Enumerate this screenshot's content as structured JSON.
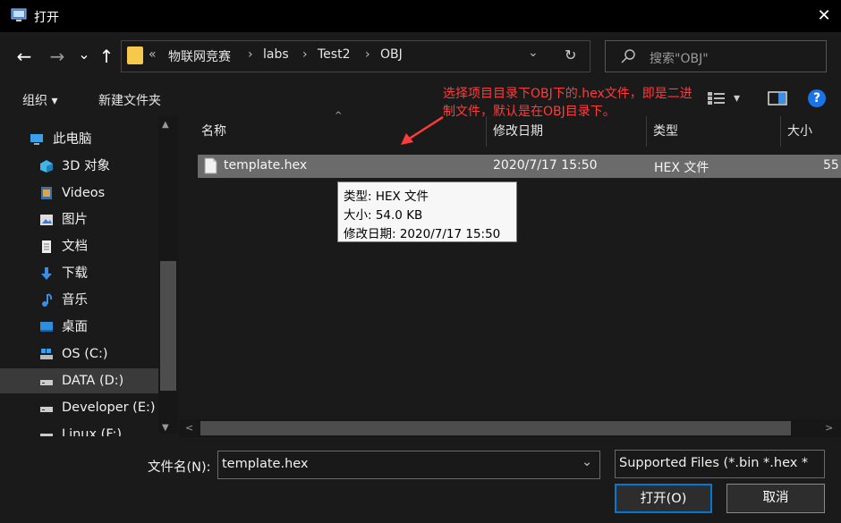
{
  "window": {
    "title": "打开",
    "close": "✕"
  },
  "nav": {
    "back": "←",
    "forward": "→",
    "recent": "⌄",
    "up": "↑"
  },
  "address": {
    "overflow": "«",
    "crumbs": [
      "物联网竞赛",
      "labs",
      "Test2",
      "OBJ"
    ],
    "sep": "›",
    "dropdown": "⌄",
    "refresh": "↻"
  },
  "search": {
    "placeholder": "搜索\"OBJ\""
  },
  "toolbar": {
    "organize": "组织 ▾",
    "new_folder": "新建文件夹",
    "view_dropdown": "▾",
    "help": "?"
  },
  "annotation": "选择项目目录下OBJ下的.hex文件，即是二进制文件，默认是在OBJ目录下。",
  "sidebar": {
    "items": [
      {
        "label": "此电脑"
      },
      {
        "label": "3D 对象"
      },
      {
        "label": "Videos"
      },
      {
        "label": "图片"
      },
      {
        "label": "文档"
      },
      {
        "label": "下载"
      },
      {
        "label": "音乐"
      },
      {
        "label": "桌面"
      },
      {
        "label": "OS (C:)"
      },
      {
        "label": "DATA (D:)"
      },
      {
        "label": "Developer (E:)"
      },
      {
        "label": "Linux (F:)"
      }
    ]
  },
  "columns": {
    "name": "名称",
    "modified": "修改日期",
    "type": "类型",
    "size": "大小"
  },
  "files": [
    {
      "name": "template.hex",
      "modified": "2020/7/17 15:50",
      "type": "HEX 文件",
      "size": "55"
    }
  ],
  "tooltip": {
    "type": "类型: HEX 文件",
    "size": "大小: 54.0 KB",
    "modified": "修改日期: 2020/7/17 15:50"
  },
  "bottom": {
    "filename_label": "文件名(N):",
    "filename_value": "template.hex",
    "filter_value": "Supported Files (*.bin *.hex *",
    "open_button": "打开(O)",
    "cancel_button": "取消"
  },
  "colors": {
    "accent": "#0078d7",
    "annotation": "#ff3b3b",
    "folder": "#f6c84c"
  }
}
